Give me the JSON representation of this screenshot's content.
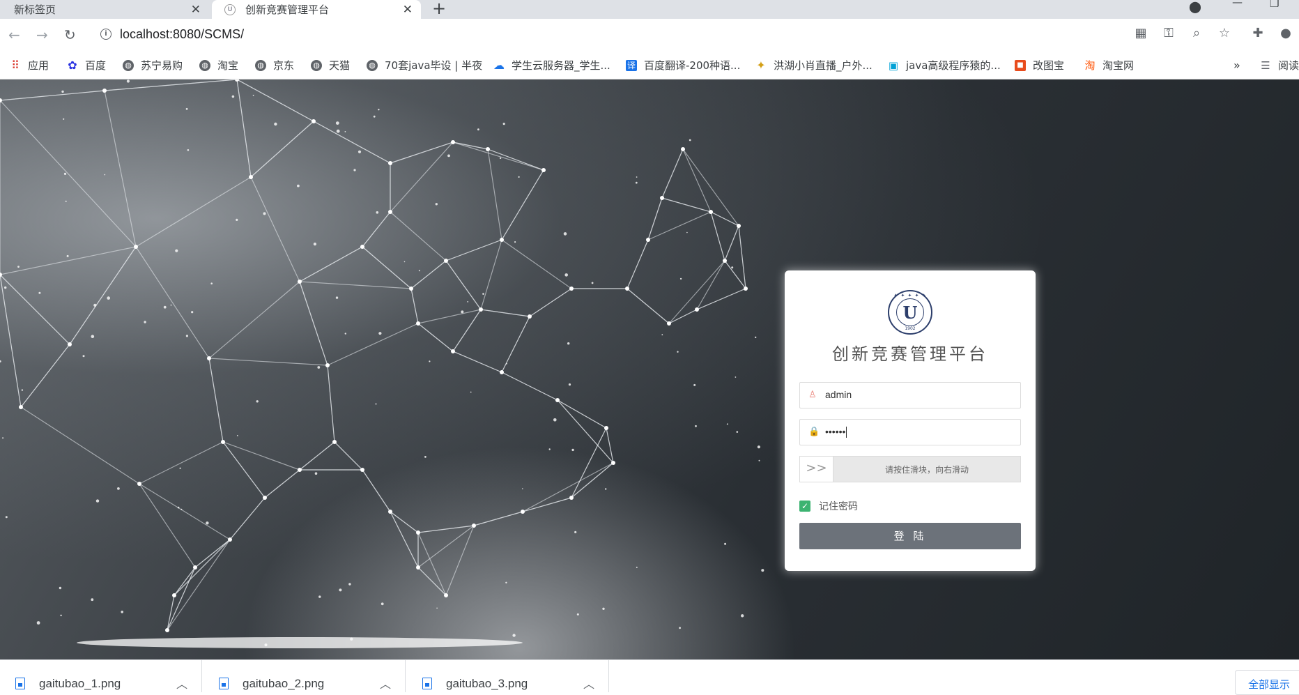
{
  "browser": {
    "tabs": [
      {
        "label": "新标签页",
        "active": false
      },
      {
        "label": "创新竞赛管理平台",
        "active": true
      }
    ],
    "url": "localhost:8080/SCMS/",
    "bookmarks": [
      {
        "label": "应用",
        "icon": "apps-grid-icon"
      },
      {
        "label": "百度",
        "icon": "baidu-paw-icon"
      },
      {
        "label": "苏宁易购",
        "icon": "globe-icon"
      },
      {
        "label": "淘宝",
        "icon": "globe-icon"
      },
      {
        "label": "京东",
        "icon": "globe-icon"
      },
      {
        "label": "天猫",
        "icon": "globe-icon"
      },
      {
        "label": "70套java毕设 | 半夜",
        "icon": "globe-icon"
      },
      {
        "label": "学生云服务器_学生...",
        "icon": "cloud-icon"
      },
      {
        "label": "百度翻译-200种语...",
        "icon": "translate-icon"
      },
      {
        "label": "洪湖小肖直播_户外...",
        "icon": "bird-icon"
      },
      {
        "label": "java高级程序猿的...",
        "icon": "bilibili-icon"
      },
      {
        "label": "改图宝",
        "icon": "gaitubao-icon"
      },
      {
        "label": "淘宝网",
        "icon": "taobao-icon"
      }
    ],
    "bookmarks_more": "»",
    "reading_list": "阅读"
  },
  "login": {
    "title": "创新竞赛管理平台",
    "logo_year": "1902",
    "username_value": "admin",
    "password_mask": "••••••",
    "slider_hint": "请按住滑块，向右滑动",
    "slider_handle": ">>",
    "remember_label": "记住密码",
    "remember_checked": true,
    "submit_label": "登 陆"
  },
  "downloads": {
    "items": [
      {
        "name": "gaitubao_1.png"
      },
      {
        "name": "gaitubao_2.png"
      },
      {
        "name": "gaitubao_3.png"
      }
    ],
    "show_all": "全部显示"
  },
  "colors": {
    "accent_icon": "#e8796e",
    "checkbox": "#3cb371",
    "login_button": "#6c727a",
    "link_blue": "#1a73e8"
  }
}
